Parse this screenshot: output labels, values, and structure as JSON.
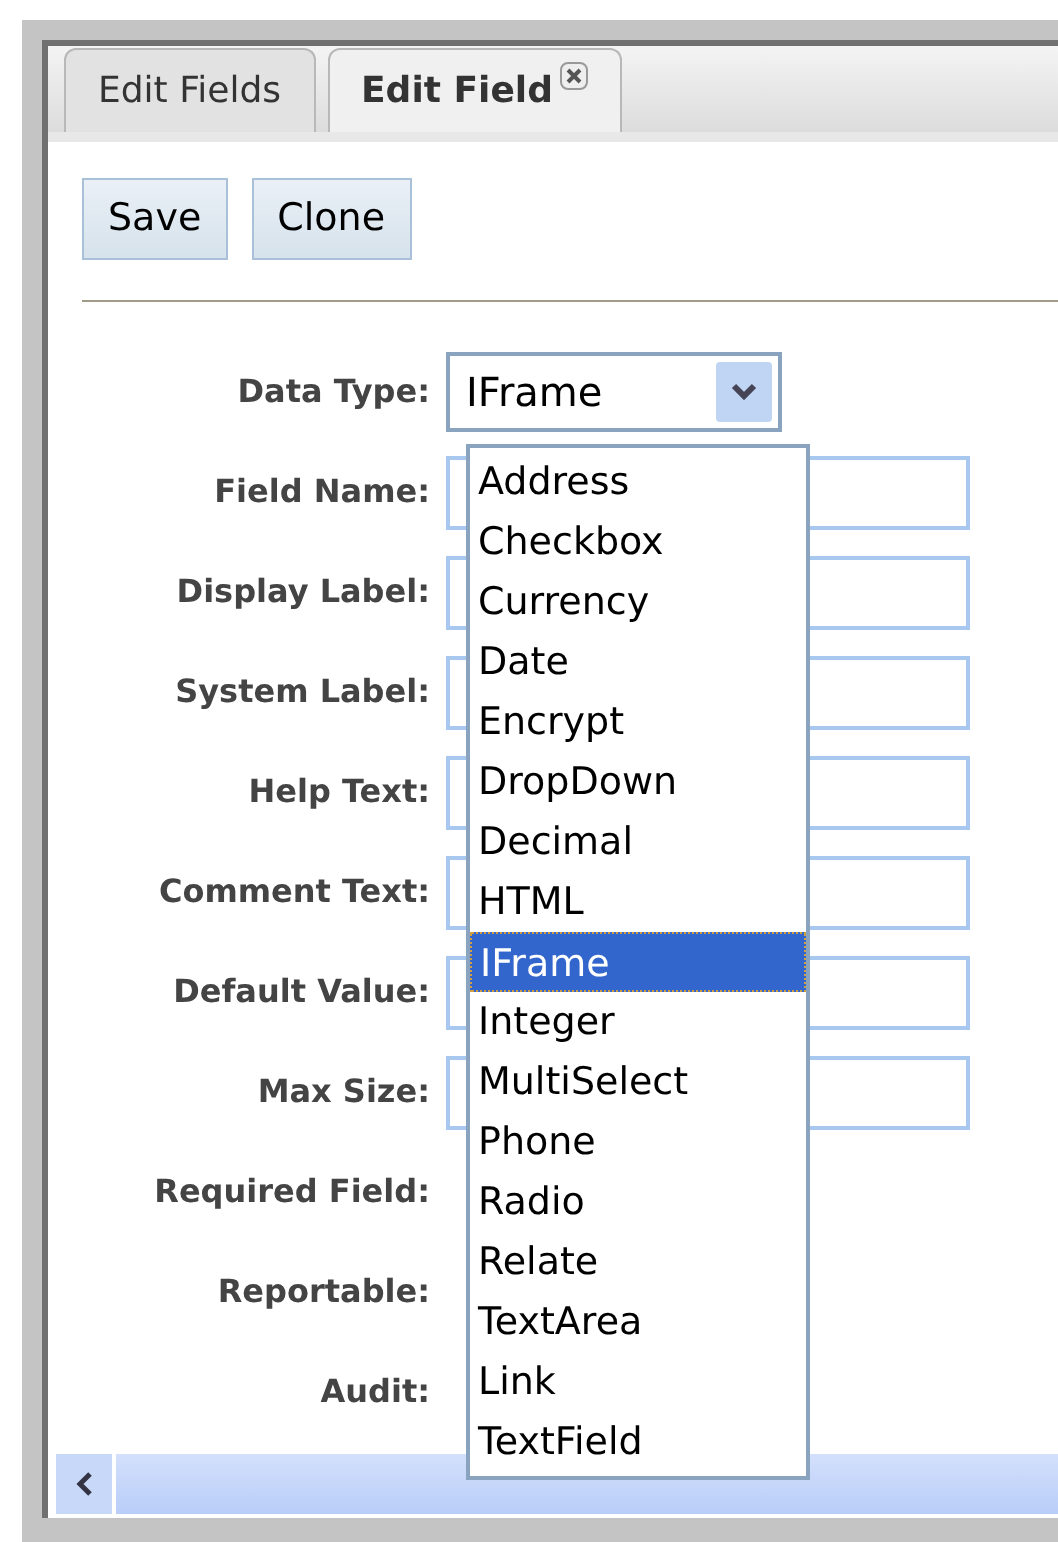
{
  "tabs": [
    {
      "label": "Edit Fields",
      "selected": false,
      "closable": false
    },
    {
      "label": "Edit Field",
      "selected": true,
      "closable": true
    }
  ],
  "buttons": [
    "Save",
    "Clone"
  ],
  "data_type": {
    "label": "Data Type:",
    "value": "IFrame",
    "options": [
      {
        "label": "Address",
        "selected": false
      },
      {
        "label": "Checkbox",
        "selected": false
      },
      {
        "label": "Currency",
        "selected": false
      },
      {
        "label": "Date",
        "selected": false
      },
      {
        "label": "Encrypt",
        "selected": false
      },
      {
        "label": "DropDown",
        "selected": false
      },
      {
        "label": "Decimal",
        "selected": false
      },
      {
        "label": "HTML",
        "selected": false
      },
      {
        "label": "IFrame",
        "selected": true
      },
      {
        "label": "Integer",
        "selected": false
      },
      {
        "label": "MultiSelect",
        "selected": false
      },
      {
        "label": "Phone",
        "selected": false
      },
      {
        "label": "Radio",
        "selected": false
      },
      {
        "label": "Relate",
        "selected": false
      },
      {
        "label": "TextArea",
        "selected": false
      },
      {
        "label": "Link",
        "selected": false
      },
      {
        "label": "TextField",
        "selected": false
      }
    ]
  },
  "fields": [
    {
      "label": "Field Name:",
      "kind": "text"
    },
    {
      "label": "Display Label:",
      "kind": "text"
    },
    {
      "label": "System Label:",
      "kind": "text"
    },
    {
      "label": "Help Text:",
      "kind": "text"
    },
    {
      "label": "Comment Text:",
      "kind": "text"
    },
    {
      "label": "Default Value:",
      "kind": "text"
    },
    {
      "label": "Max Size:",
      "kind": "text"
    },
    {
      "label": "Required Field:",
      "kind": "other"
    },
    {
      "label": "Reportable:",
      "kind": "other"
    },
    {
      "label": "Audit:",
      "kind": "other"
    }
  ]
}
